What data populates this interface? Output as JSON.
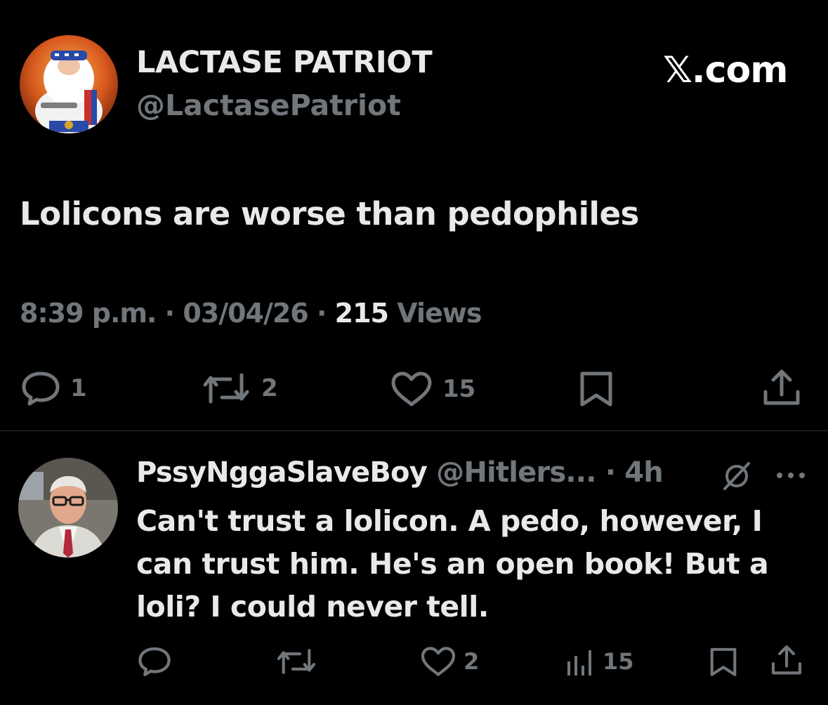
{
  "tweet": {
    "author": {
      "display_name": "LACTASE PATRIOT",
      "handle": "@LactasePatriot"
    },
    "watermark": "𝕏.com",
    "text": "Lolicons are worse than pedophiles",
    "time": "8:39 p.m.",
    "sep1": " · ",
    "date": "03/04/26",
    "sep2": " · ",
    "views_count": "215",
    "views_label": " Views",
    "actions": {
      "replies": "1",
      "reposts": "2",
      "likes": "15"
    },
    "icons": [
      "reply-icon",
      "repost-icon",
      "like-icon",
      "bookmark-icon",
      "share-icon"
    ]
  },
  "reply": {
    "display_name": "PssyNggaSlaveBoy",
    "handle": " @Hitlers...",
    "sep": " · ",
    "time": "4h",
    "text": "Can't trust a lolicon. A pedo, however, I can trust him. He's an open book! But a loli? I could never tell.",
    "actions": {
      "replies": "",
      "reposts": "",
      "likes": "2",
      "views": "15"
    },
    "icons": [
      "grok-icon",
      "more-icon",
      "reply-icon",
      "repost-icon",
      "like-icon",
      "views-icon",
      "bookmark-icon",
      "share-icon"
    ]
  },
  "colors": {
    "background": "#000000",
    "primary_text": "#e7e9ea",
    "secondary_text": "#71767b",
    "divider": "#2f3336"
  }
}
